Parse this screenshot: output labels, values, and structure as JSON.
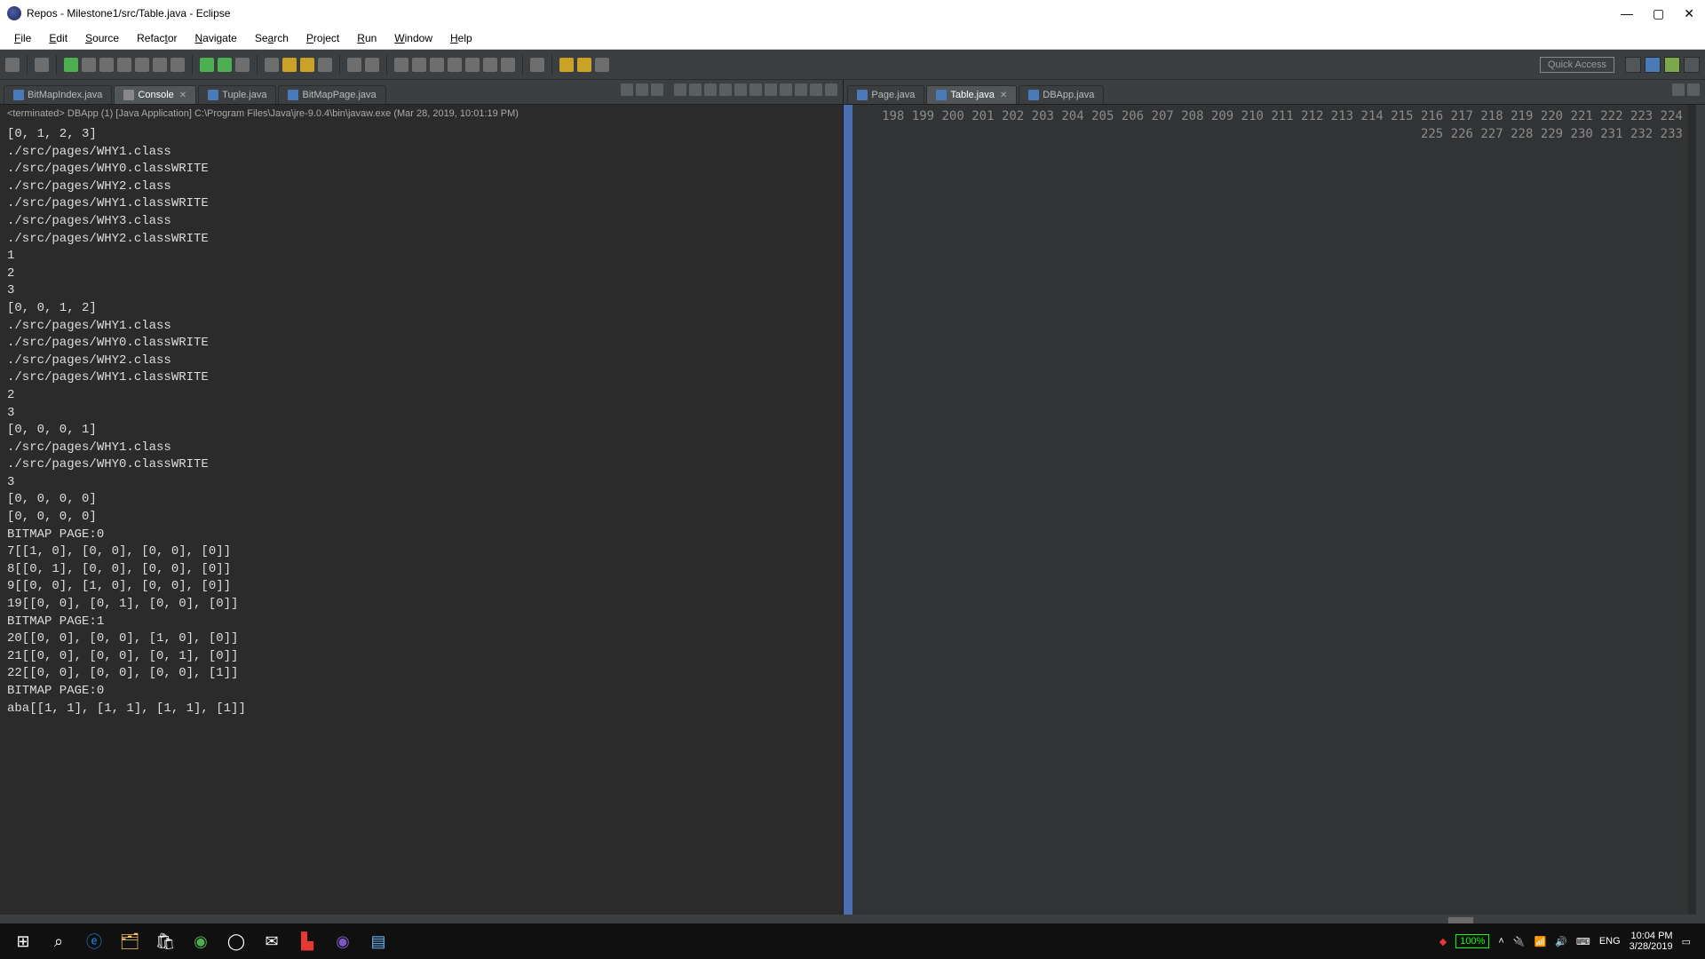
{
  "window": {
    "title": "Repos - Milestone1/src/Table.java - Eclipse"
  },
  "menubar": [
    "File",
    "Edit",
    "Source",
    "Refactor",
    "Navigate",
    "Search",
    "Project",
    "Run",
    "Window",
    "Help"
  ],
  "quick_access": "Quick Access",
  "left": {
    "tabs": [
      {
        "label": "BitMapIndex.java",
        "active": false
      },
      {
        "label": "Console",
        "active": true,
        "closable": true
      },
      {
        "label": "Tuple.java",
        "active": false
      },
      {
        "label": "BitMapPage.java",
        "active": false
      }
    ],
    "terminated_line": "<terminated> DBApp (1) [Java Application] C:\\Program Files\\Java\\jre-9.0.4\\bin\\javaw.exe (Mar 28, 2019, 10:01:19 PM)",
    "console_lines": [
      "[0, 1, 2, 3]",
      "./src/pages/WHY1.class",
      "./src/pages/WHY0.classWRITE",
      "./src/pages/WHY2.class",
      "./src/pages/WHY1.classWRITE",
      "./src/pages/WHY3.class",
      "./src/pages/WHY2.classWRITE",
      "1",
      "2",
      "3",
      "[0, 0, 1, 2]",
      "./src/pages/WHY1.class",
      "./src/pages/WHY0.classWRITE",
      "./src/pages/WHY2.class",
      "./src/pages/WHY1.classWRITE",
      "2",
      "3",
      "[0, 0, 0, 1]",
      "./src/pages/WHY1.class",
      "./src/pages/WHY0.classWRITE",
      "3",
      "[0, 0, 0, 0]",
      "[0, 0, 0, 0]",
      "BITMAP PAGE:0",
      "7[[1, 0], [0, 0], [0, 0], [0]]",
      "8[[0, 1], [0, 0], [0, 0], [0]]",
      "9[[0, 0], [1, 0], [0, 0], [0]]",
      "19[[0, 0], [0, 1], [0, 0], [0]]",
      "BITMAP PAGE:1",
      "20[[0, 0], [0, 0], [1, 0], [0]]",
      "21[[0, 0], [0, 0], [0, 1], [0]]",
      "22[[0, 0], [0, 0], [0, 0], [1]]",
      "BITMAP PAGE:0",
      "aba[[1, 1], [1, 1], [1, 1], [1]]"
    ]
  },
  "right": {
    "tabs": [
      {
        "label": "Page.java",
        "active": false
      },
      {
        "label": "Table.java",
        "active": true,
        "closable": true
      },
      {
        "label": "DBApp.java",
        "active": false
      }
    ],
    "line_start": 198,
    "line_end": 233
  },
  "taskbar": {
    "battery": "100%",
    "lang": "ENG",
    "time": "10:04 PM",
    "date": "3/28/2019"
  }
}
